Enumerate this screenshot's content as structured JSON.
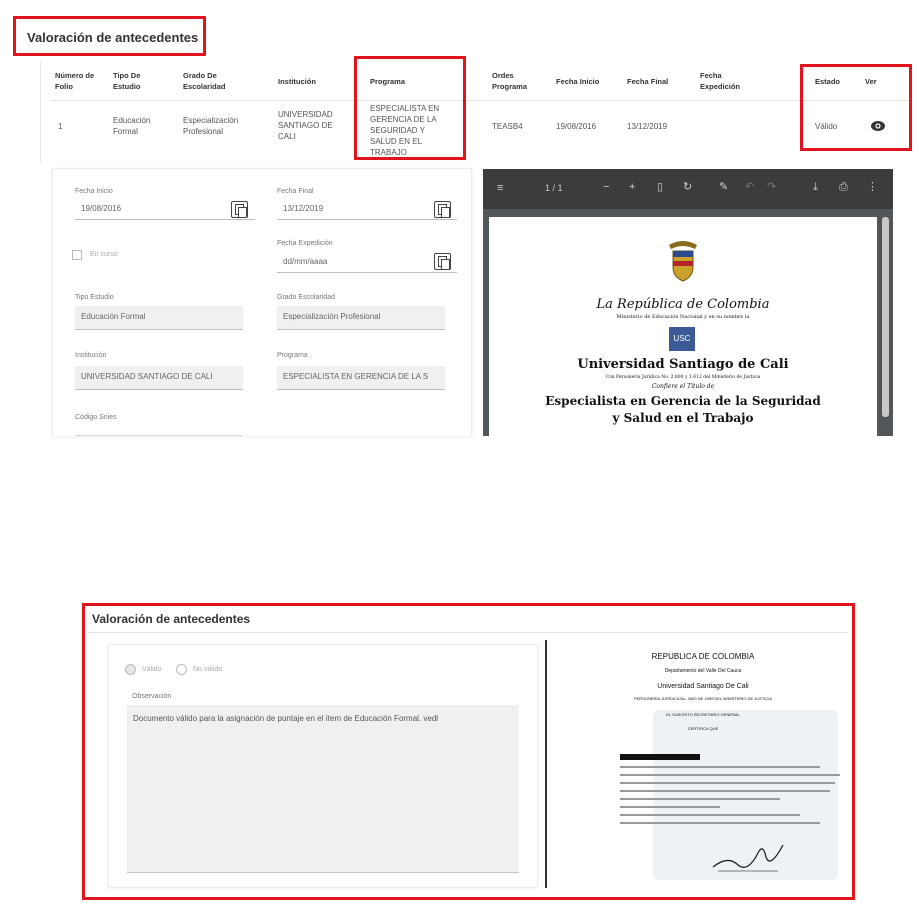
{
  "top_section": {
    "title": "Valoración de antecedentes",
    "table": {
      "headers": [
        "Número de Folio",
        "Tipo De Estudio",
        "Grado De Escolaridad",
        "Institución",
        "Programa",
        "Ordes Programa",
        "Fecha Inicio",
        "Fecha Final",
        "Fecha Expedición",
        "Estado",
        "Ver"
      ],
      "row": {
        "folio": "1",
        "tipo": "Educación Formal",
        "grado": "Especialización Profesional",
        "institucion": "UNIVERSIDAD SANTIAGO DE CALI",
        "programa": "ESPECIALISTA EN GERENCIA DE LA SEGURIDAD Y SALUD EN EL TRABAJO",
        "ordes": "TEASB4",
        "fecha_inicio": "19/08/2016",
        "fecha_final": "13/12/2019",
        "fecha_expedicion": "",
        "estado": "Válido"
      }
    },
    "form": {
      "fecha_inicio_label": "Fecha Inicio",
      "fecha_inicio_value": "19/08/2016",
      "fecha_final_label": "Fecha Final",
      "fecha_final_value": "13/12/2019",
      "fecha_expedicion_label": "Fecha Expedición",
      "fecha_expedicion_value": "dd/mm/aaaa",
      "en_curso_label": "En curso",
      "tipo_estudio_label": "Tipo Estudio",
      "tipo_estudio_value": "Educación Formal",
      "grado_label": "Grado Escolaridad",
      "grado_value": "Especialización Profesional",
      "institucion_label": "Institución",
      "institucion_value": "UNIVERSIDAD SANTIAGO DE CALI",
      "programa_label": "Programa",
      "programa_value": "ESPECIALISTA EN GERENCIA DE LA S",
      "codigo_label": "Código Snies"
    },
    "pdf": {
      "page_indicator": "1 / 1",
      "doc_line1": "La República de Colombia",
      "doc_line2": "Ministerio de Educación Nacional y en su nombre la",
      "doc_logo": "USC",
      "doc_line3": "Universidad Santiago de Cali",
      "doc_line4": "Con Personería Jurídica No. 2.800 y 1.612 del Ministerio de Justicia",
      "doc_line5": "Confiere el Título de",
      "doc_line6": "Especialista en Gerencia de la Seguridad",
      "doc_line7": "y Salud en el Trabajo"
    }
  },
  "bottom_section": {
    "title": "Valoración de antecedentes",
    "radio_valid_label": "Válido",
    "radio_invalid_label": "No válido",
    "observation_label": "Observación",
    "observation_text": "Documento válido para la asignación de puntaje en el ítem de Educación Formal. vedl",
    "cert": {
      "line1": "REPUBLICA DE COLOMBIA",
      "line2": "Departamento del Valle Del Cauca",
      "line3": "Universidad Santiago De Cali",
      "line4": "PERSONERÍA JURÍDICA No. 2800 DE 1959 DEL MINISTERIO DE JUSTICIA",
      "line5": "EL SUSCRITO SECRETARIO GENERAL",
      "line6": "CERTIFICA QUE"
    }
  },
  "colors": {
    "highlight": "#e0141c",
    "toolbar": "#3c3c3c",
    "pdf_bg": "#525659",
    "field_bg": "#f0f0f0"
  }
}
